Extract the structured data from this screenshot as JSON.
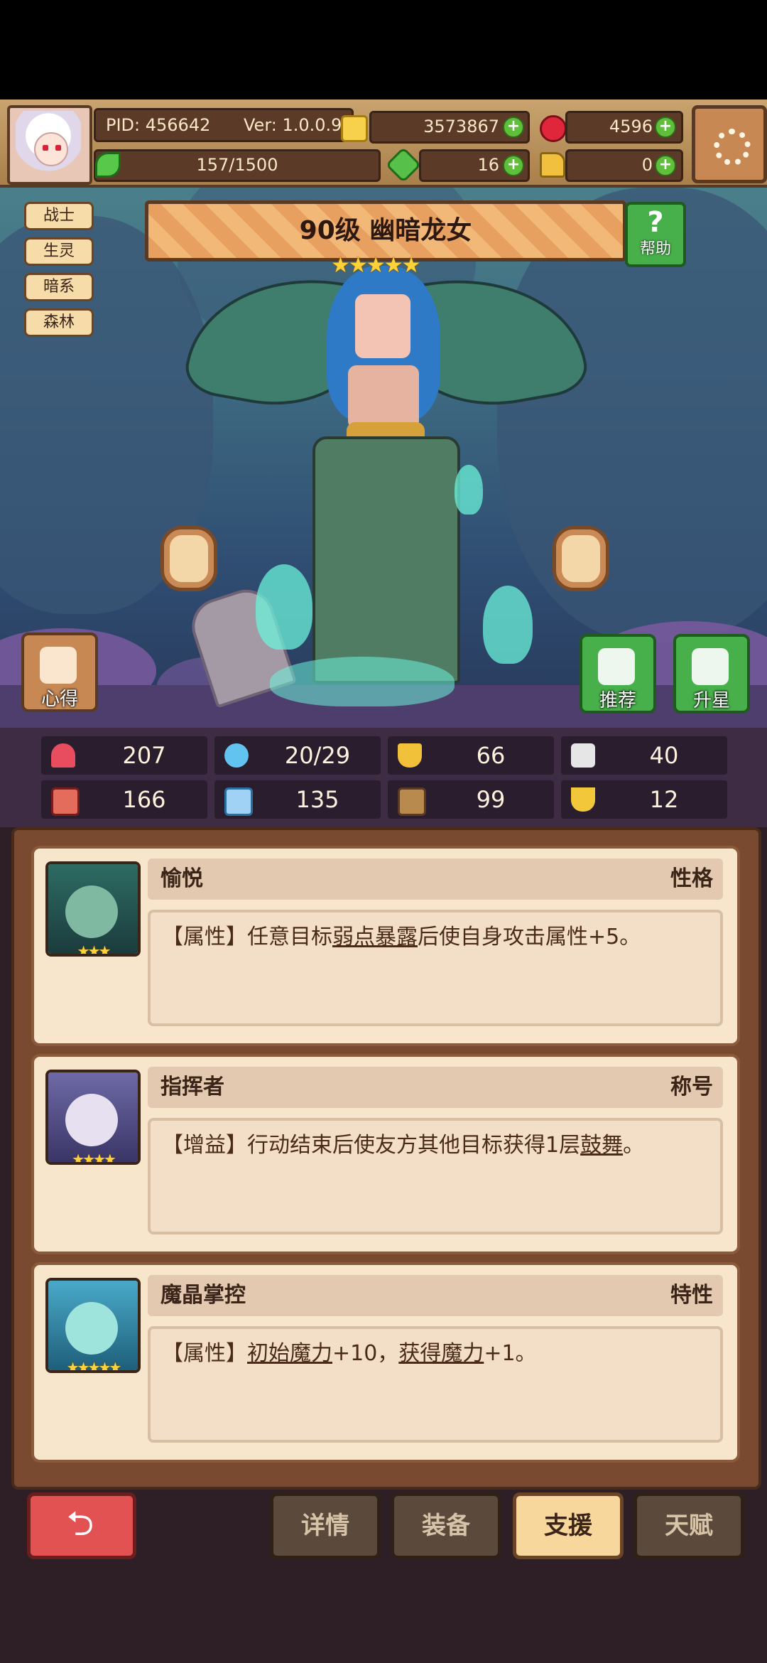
{
  "player": {
    "pid": "PID: 456642",
    "ver": "Ver: 1.0.0.9",
    "stamina": "157/1500"
  },
  "currencies": {
    "gold": "3573867",
    "ruby": "4596",
    "clover": "16",
    "boot": "0"
  },
  "tags": [
    "战士",
    "生灵",
    "暗系",
    "森林"
  ],
  "hero": {
    "title": "90级  幽暗龙女",
    "stars": "★★★★★"
  },
  "buttons": {
    "help": "帮助",
    "notes": "心得",
    "recommend": "推荐",
    "upgrade_star": "升星"
  },
  "stats": {
    "hp": "207",
    "mana": "20/29",
    "defense": "66",
    "speed": "40",
    "attack": "166",
    "magic": "135",
    "armor": "99",
    "luck": "12"
  },
  "supports": [
    {
      "name": "愉悦",
      "type": "性格",
      "rank": "★★★",
      "desc_prefix": "【属性】任意目标",
      "desc_link": "弱点暴露",
      "desc_suffix": "后使自身攻击属性+5。"
    },
    {
      "name": "指挥者",
      "type": "称号",
      "rank": "★★★★",
      "desc_prefix": "【增益】行动结束后使友方其他目标获得1层",
      "desc_link": "鼓舞",
      "desc_suffix": "。"
    },
    {
      "name": "魔晶掌控",
      "type": "特性",
      "rank": "★★★★★",
      "desc_prefix": "【属性】",
      "desc_link": "初始魔力",
      "desc_mid": "+10，",
      "desc_link2": "获得魔力",
      "desc_suffix": "+1。"
    }
  ],
  "nav": {
    "back": "⮌",
    "details": "详情",
    "equipment": "装备",
    "support": "支援",
    "talent": "天赋"
  }
}
